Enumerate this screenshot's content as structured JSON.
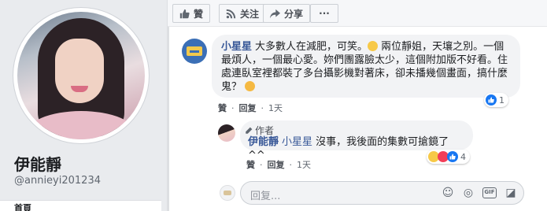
{
  "profile": {
    "name": "伊能靜",
    "handle": "@annieyi201234",
    "tab_label": "首頁"
  },
  "action_bar": {
    "like_label": "贊",
    "follow_label": "关注",
    "share_label": "分享",
    "more_label": "···"
  },
  "comment": {
    "author": "小星星",
    "text_part1": "大多數人在減肥，可笑。",
    "text_part2": " 兩位靜姐，天壤之別。一個最煩人，一個最心愛。妳們團露臉太少，這個附加版不好看。住處連臥室裡都裝了多台攝影機對著床，卻未播幾個畫面，搞什麼鬼？",
    "like_link": "贊",
    "reply_link": "回复",
    "time": "1天",
    "reaction_count": "1"
  },
  "reply": {
    "author_tag": "作者",
    "author": "伊能靜",
    "reply_to": "小星星",
    "text": " 沒事，我後面的集數可搶鏡了^^",
    "like_link": "贊",
    "reply_link": "回复",
    "time": "1天",
    "reaction_count": "4"
  },
  "composer": {
    "placeholder": "回复..."
  },
  "colors": {
    "link_blue": "#385898",
    "like_blue": "#1877f2",
    "bubble_gray": "#f2f3f5"
  }
}
